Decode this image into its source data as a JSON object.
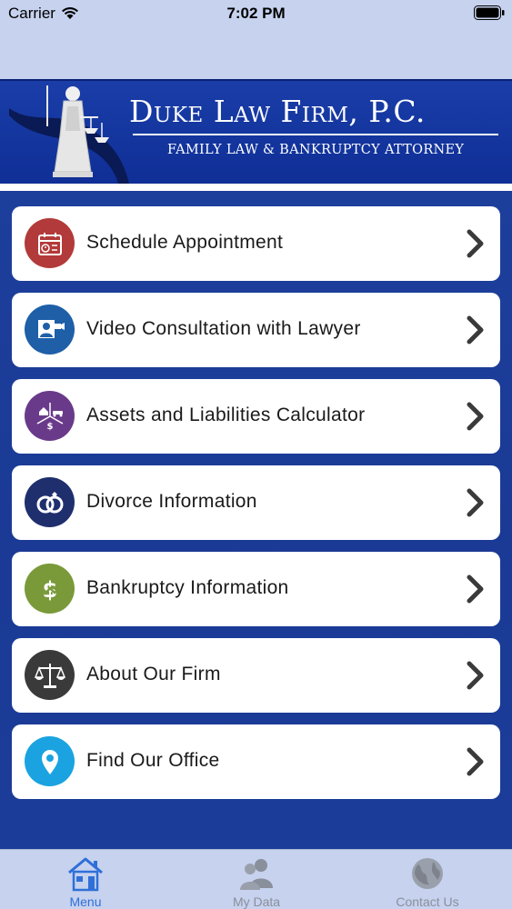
{
  "status_bar": {
    "carrier": "Carrier",
    "time": "7:02 PM"
  },
  "header": {
    "firm_name": "Duke Law Firm, P.C.",
    "subtitle": "FAMILY LAW & BANKRUPTCY ATTORNEY"
  },
  "menu": {
    "items": [
      {
        "label": "Schedule Appointment",
        "icon": "calendar-icon",
        "color": "#b33a3a"
      },
      {
        "label": "Video Consultation with Lawyer",
        "icon": "video-consultation-icon",
        "color": "#1e5fa8"
      },
      {
        "label": "Assets and Liabilities Calculator",
        "icon": "assets-icon",
        "color": "#6a3a8a"
      },
      {
        "label": "Divorce Information",
        "icon": "rings-icon",
        "color": "#1f2f6e"
      },
      {
        "label": "Bankruptcy Information",
        "icon": "broken-dollar-icon",
        "color": "#7a9a3a"
      },
      {
        "label": "About Our Firm",
        "icon": "scales-icon",
        "color": "#3a3a3a"
      },
      {
        "label": "Find Our Office",
        "icon": "location-pin-icon",
        "color": "#1aa3e0"
      }
    ]
  },
  "tabbar": {
    "tabs": [
      {
        "label": "Menu",
        "icon": "house-icon",
        "active": true
      },
      {
        "label": "My Data",
        "icon": "people-icon",
        "active": false
      },
      {
        "label": "Contact Us",
        "icon": "globe-icon",
        "active": false
      }
    ],
    "active_color": "#2f6fd8",
    "inactive_color": "#8a8f9c"
  }
}
